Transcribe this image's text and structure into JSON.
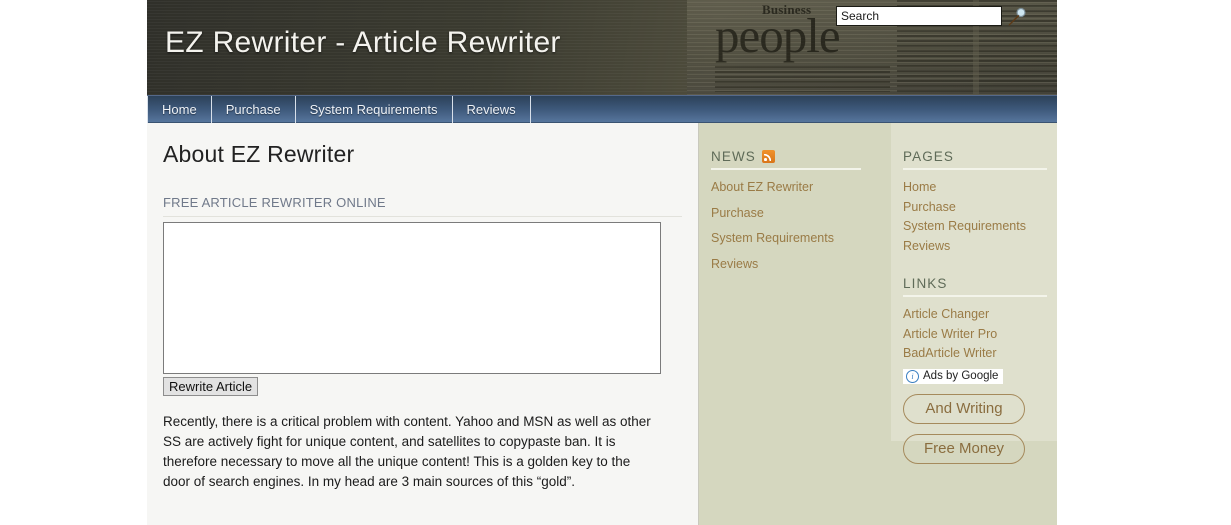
{
  "header": {
    "site_title": "EZ Rewriter - Article Rewriter",
    "newspaper_kicker": "Business",
    "newspaper_headline": "people",
    "search": {
      "value": "Search",
      "placeholder": "Search",
      "button_icon": "search-icon"
    }
  },
  "nav": {
    "items": [
      {
        "label": "Home"
      },
      {
        "label": "Purchase"
      },
      {
        "label": "System Requirements"
      },
      {
        "label": "Reviews"
      }
    ]
  },
  "main": {
    "page_title": "About EZ Rewriter",
    "section_label": "FREE ARTICLE REWRITER ONLINE",
    "textarea_value": "",
    "textarea_placeholder": "",
    "submit_label": "Rewrite Article",
    "paragraph": "Recently, there is a critical problem with content.\nYahoo and MSN as well as other SS are actively fight for unique content, and satellites to copypaste ban. It is therefore necessary to move all the unique content! This is a golden key to the door of search engines. In my head are 3 main sources of this “gold”."
  },
  "sidebar_news": {
    "title": "NEWS",
    "icon": "rss-icon",
    "items": [
      {
        "label": "About EZ Rewriter"
      },
      {
        "label": "Purchase"
      },
      {
        "label": "System Requirements"
      },
      {
        "label": "Reviews"
      }
    ]
  },
  "sidebar_pages": {
    "title": "PAGES",
    "items": [
      {
        "label": "Home"
      },
      {
        "label": "Purchase"
      },
      {
        "label": "System Requirements"
      },
      {
        "label": "Reviews"
      }
    ]
  },
  "sidebar_links": {
    "title": "LINKS",
    "items": [
      {
        "label": "Article Changer"
      },
      {
        "label": "Article Writer Pro"
      },
      {
        "label": "BadArticle Writer"
      }
    ]
  },
  "ads": {
    "badge_label": "Ads by Google",
    "badge_icon": "info-icon",
    "buttons": [
      {
        "label": "And Writing"
      },
      {
        "label": "Free Money"
      }
    ]
  },
  "colors": {
    "header_bg": "#3a3a2e",
    "nav_bg": "#3d587a",
    "sidebar_bg": "#d5d7bf",
    "widget_panel_bg": "#dfe0cd",
    "content_bg": "#f6f6f4",
    "link_color": "#9a7b46",
    "widget_title_color": "#5f6b58",
    "ad_border": "#a58a5c",
    "rss_orange": "#e8821f"
  }
}
